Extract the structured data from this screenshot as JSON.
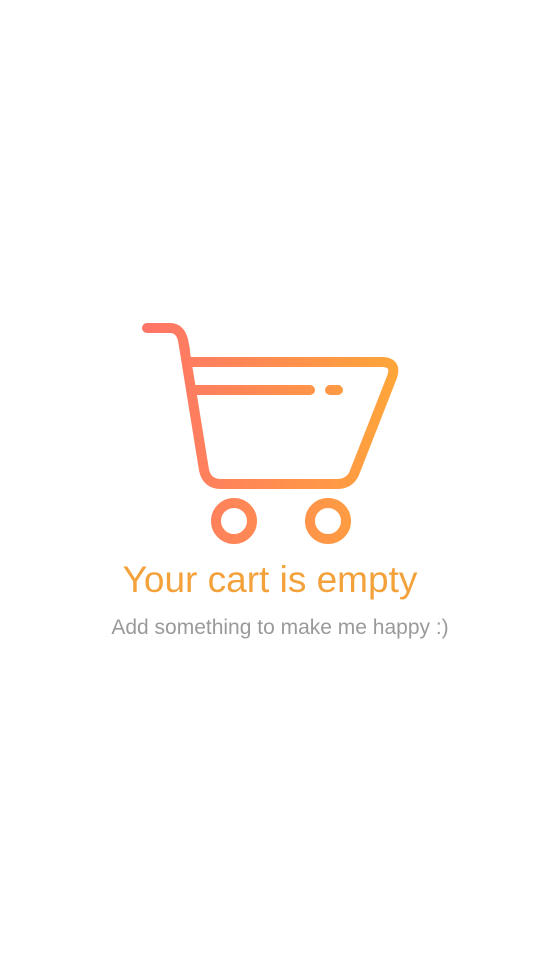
{
  "empty_cart": {
    "icon": "shopping-cart-icon",
    "title": "Your cart is empty",
    "subtitle": "Add something to make me happy :)"
  },
  "colors": {
    "gradient_start": "#FF7468",
    "gradient_end": "#FFA53A",
    "title": "#F3A23B",
    "subtitle": "#9A9A9A",
    "background": "#FFFFFF"
  }
}
